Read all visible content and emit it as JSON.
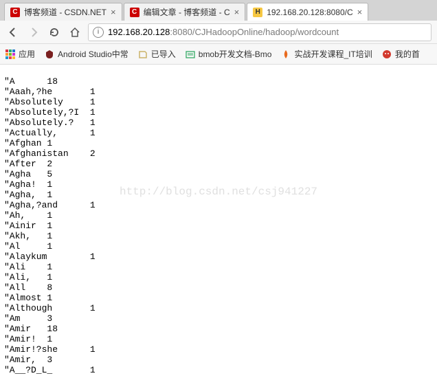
{
  "tabs": [
    {
      "title": "博客频道 - CSDN.NET",
      "icon": "C",
      "iconBg": "#cc0000",
      "iconFg": "#fff"
    },
    {
      "title": "编辑文章 - 博客频道 - C",
      "icon": "C",
      "iconBg": "#cc0000",
      "iconFg": "#fff"
    },
    {
      "title": "192.168.20.128:8080/C",
      "icon": "H",
      "iconBg": "#f7c843",
      "iconFg": "#333"
    }
  ],
  "nav": {
    "backDisabled": false,
    "fwdDisabled": true
  },
  "url": {
    "host": "192.168.20.128",
    "path": ":8080/CJHadoopOnline/hadoop/wordcount"
  },
  "bookmarks": {
    "appsLabel": "应用",
    "items": [
      {
        "label": "Android Studio中常",
        "color": "#7a1f1f"
      },
      {
        "label": "已导入",
        "color": "#ccb46a"
      },
      {
        "label": "bmob开发文档-Bmo",
        "color": "#3a6"
      },
      {
        "label": "实战开发课程_IT培训",
        "color": "#e86a1e"
      },
      {
        "label": "我的首",
        "color": "#d23a2e"
      }
    ]
  },
  "watermark": "http://blog.csdn.net/csj941227",
  "wordcount": [
    {
      "w": "\"A",
      "c": 18
    },
    {
      "w": "\"Aaah,?he",
      "c": 1
    },
    {
      "w": "\"Absolutely",
      "c": 1
    },
    {
      "w": "\"Absolutely,?I",
      "c": 1
    },
    {
      "w": "\"Absolutely.?",
      "c": 1
    },
    {
      "w": "\"Actually,",
      "c": 1
    },
    {
      "w": "\"Afghan",
      "c": 1
    },
    {
      "w": "\"Afghanistan",
      "c": 2
    },
    {
      "w": "\"After",
      "c": 2
    },
    {
      "w": "\"Agha",
      "c": 5
    },
    {
      "w": "\"Agha!",
      "c": 1
    },
    {
      "w": "\"Agha,",
      "c": 1
    },
    {
      "w": "\"Agha,?and",
      "c": 1
    },
    {
      "w": "\"Ah,",
      "c": 1
    },
    {
      "w": "\"Ainir",
      "c": 1
    },
    {
      "w": "\"Akh,",
      "c": 1
    },
    {
      "w": "\"Al",
      "c": 1
    },
    {
      "w": "\"Alaykum",
      "c": 1
    },
    {
      "w": "\"Ali",
      "c": 1
    },
    {
      "w": "\"Ali,",
      "c": 1
    },
    {
      "w": "\"All",
      "c": 8
    },
    {
      "w": "\"Almost",
      "c": 1
    },
    {
      "w": "\"Although",
      "c": 1
    },
    {
      "w": "\"Am",
      "c": 3
    },
    {
      "w": "\"Amir",
      "c": 18
    },
    {
      "w": "\"Amir!",
      "c": 1
    },
    {
      "w": "\"Amir!?she",
      "c": 1
    },
    {
      "w": "\"Amir,",
      "c": 3
    },
    {
      "w": "\"A__?D_L_",
      "c": 1
    }
  ]
}
